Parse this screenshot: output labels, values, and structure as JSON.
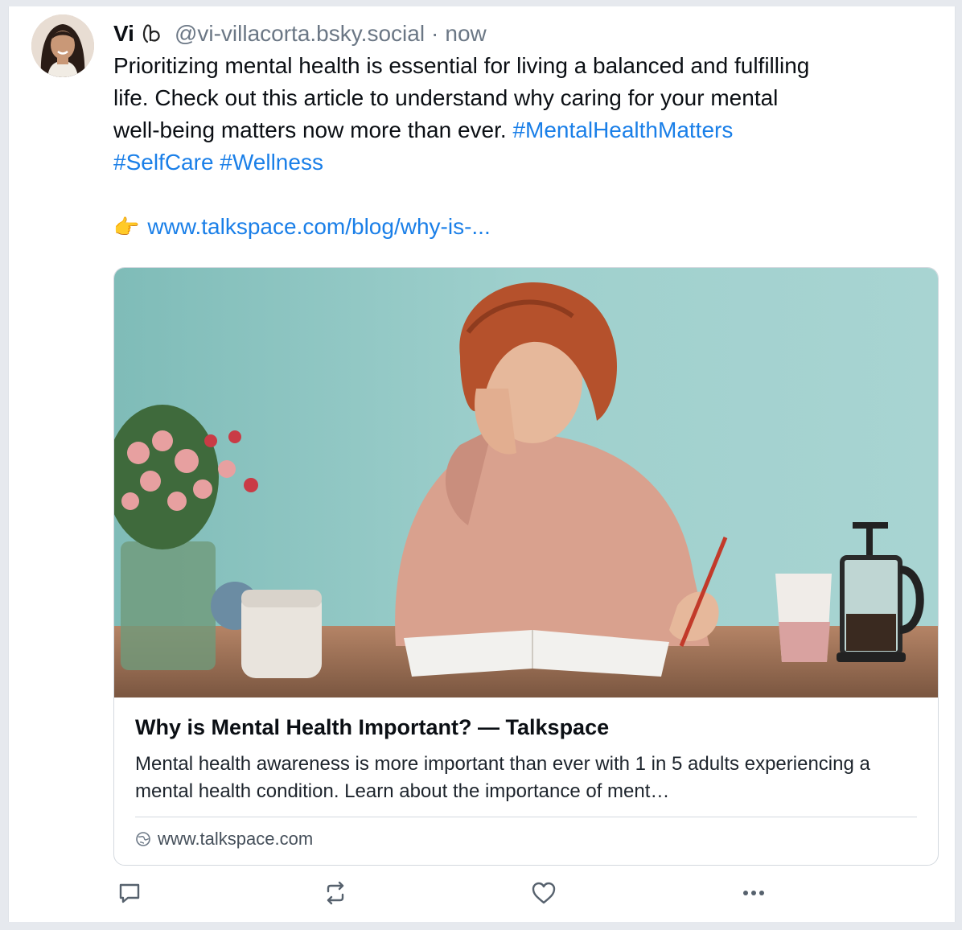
{
  "post": {
    "author": {
      "display_name": "Vi",
      "handle": "@vi-villacorta.bsky.social",
      "separator": "·",
      "time": "now",
      "avatar_icon": "avatar-photo"
    },
    "text": {
      "line1": "Prioritizing mental health is essential for living a balanced and fulfilling",
      "line2": "life. Check out this article to understand why caring for your mental",
      "line3": "well-being matters now more than ever. ",
      "hashtags": [
        "#MentalHealthMatters",
        "#SelfCare",
        "#Wellness"
      ]
    },
    "link": {
      "emoji": "👉",
      "url_text": "www.talkspace.com/blog/why-is-..."
    },
    "card": {
      "title": "Why is Mental Health Important? — Talkspace",
      "description": "Mental health awareness is more important than ever with 1 in 5 adults experiencing a mental health condition. Learn about the importance of ment…",
      "domain": "www.talkspace.com",
      "image_icon": "woman-writing-in-notebook-image"
    },
    "actions": {
      "reply_icon": "reply-icon",
      "repost_icon": "repost-icon",
      "like_icon": "heart-icon",
      "more_icon": "more-icon"
    }
  },
  "colors": {
    "link": "#1a7fe8",
    "muted": "#6b7785",
    "text": "#0b0f14",
    "border": "#d4d9df"
  }
}
